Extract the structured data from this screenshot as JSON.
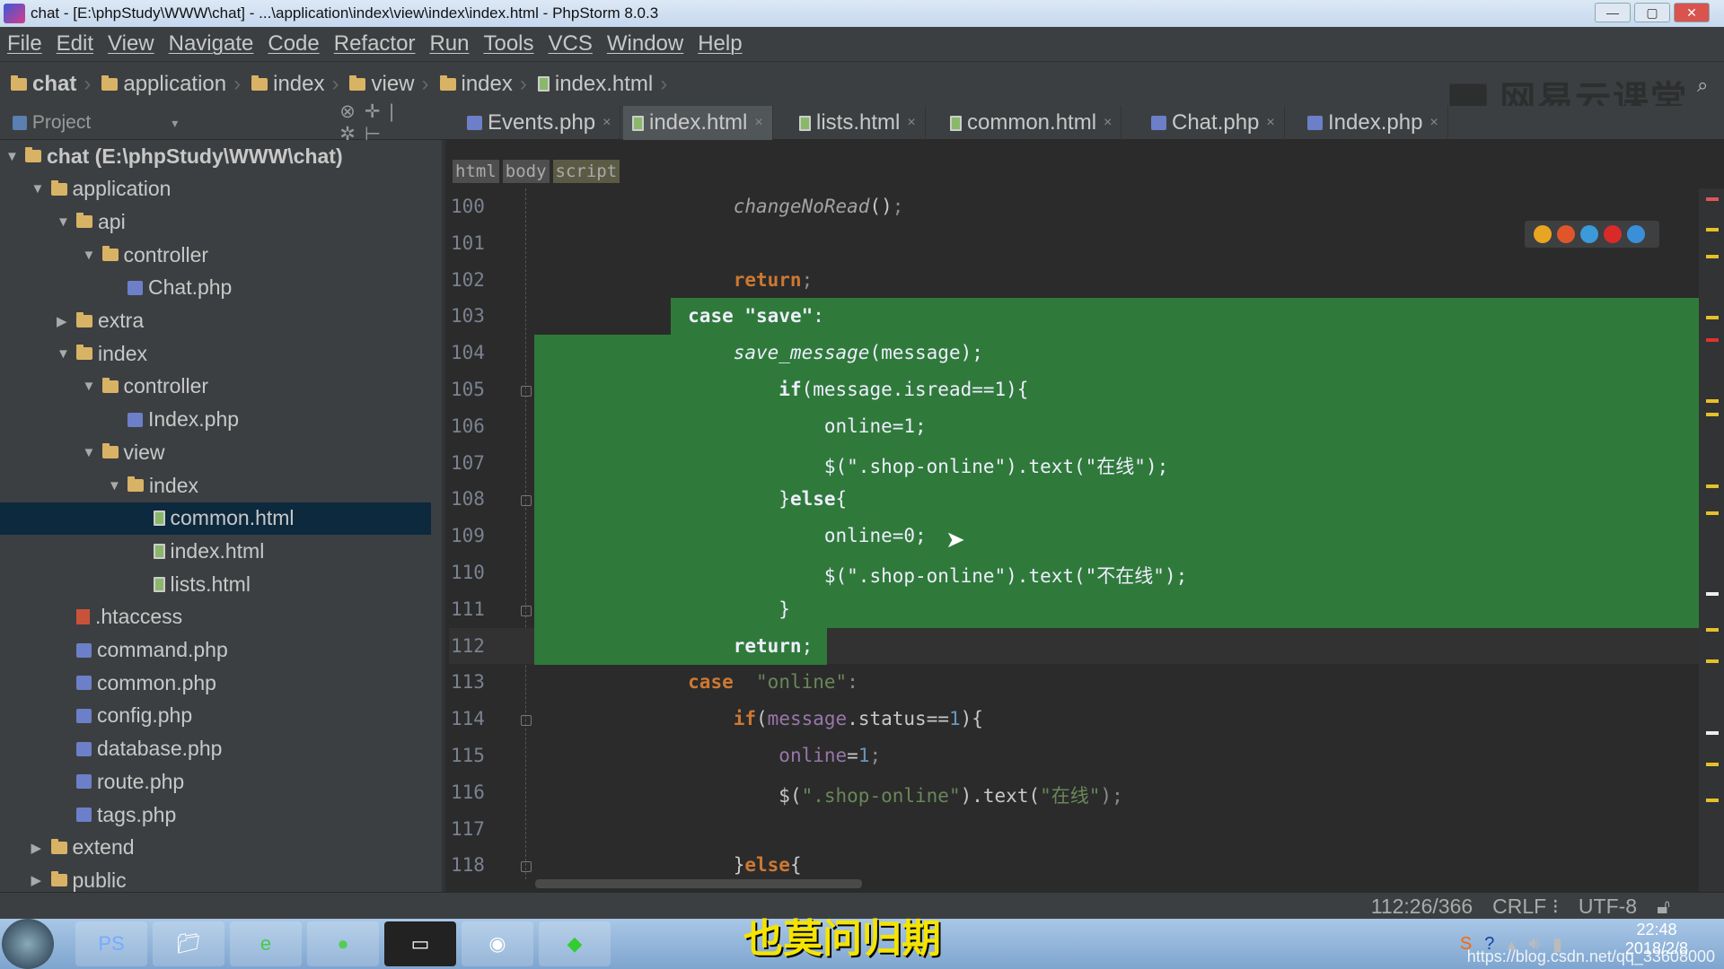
{
  "window": {
    "title": "chat - [E:\\phpStudy\\WWW\\chat] - ...\\application\\index\\view\\index\\index.html - PhpStorm 8.0.3",
    "min": "—",
    "max": "▢",
    "close": "✕"
  },
  "menu": [
    "File",
    "Edit",
    "View",
    "Navigate",
    "Code",
    "Refactor",
    "Run",
    "Tools",
    "VCS",
    "Window",
    "Help"
  ],
  "breadcrumb": [
    {
      "label": "chat",
      "icon": "folder"
    },
    {
      "label": "application",
      "icon": "folder"
    },
    {
      "label": "index",
      "icon": "folder"
    },
    {
      "label": "view",
      "icon": "folder"
    },
    {
      "label": "index",
      "icon": "folder"
    },
    {
      "label": "index.html",
      "icon": "html-file"
    }
  ],
  "watermark": "网易云课堂",
  "project_panel": {
    "label": "Project"
  },
  "tabs": [
    {
      "label": "Events.php",
      "icon": "php"
    },
    {
      "label": "index.html",
      "icon": "html",
      "active": true
    },
    {
      "label": "lists.html",
      "icon": "html"
    },
    {
      "label": "common.html",
      "icon": "html"
    },
    {
      "label": "Chat.php",
      "icon": "php"
    },
    {
      "label": "Index.php",
      "icon": "php"
    }
  ],
  "tab_close": "×",
  "tree": [
    {
      "label": "chat (E:\\phpStudy\\WWW\\chat)",
      "level": 0,
      "type": "folder",
      "expanded": true
    },
    {
      "label": "application",
      "level": 1,
      "type": "folder",
      "expanded": true
    },
    {
      "label": "api",
      "level": 2,
      "type": "folder",
      "expanded": true
    },
    {
      "label": "controller",
      "level": 3,
      "type": "folder",
      "expanded": true
    },
    {
      "label": "Chat.php",
      "level": 4,
      "type": "php"
    },
    {
      "label": "extra",
      "level": 2,
      "type": "folder",
      "expanded": false
    },
    {
      "label": "index",
      "level": 2,
      "type": "folder",
      "expanded": true
    },
    {
      "label": "controller",
      "level": 3,
      "type": "folder",
      "expanded": true
    },
    {
      "label": "Index.php",
      "level": 4,
      "type": "php"
    },
    {
      "label": "view",
      "level": 3,
      "type": "folder",
      "expanded": true
    },
    {
      "label": "index",
      "level": 4,
      "type": "folder",
      "expanded": true
    },
    {
      "label": "common.html",
      "level": 5,
      "type": "html",
      "selected": true
    },
    {
      "label": "index.html",
      "level": 5,
      "type": "html"
    },
    {
      "label": "lists.html",
      "level": 5,
      "type": "html"
    },
    {
      "label": ".htaccess",
      "level": 2,
      "type": "htaccess"
    },
    {
      "label": "command.php",
      "level": 2,
      "type": "php"
    },
    {
      "label": "common.php",
      "level": 2,
      "type": "php"
    },
    {
      "label": "config.php",
      "level": 2,
      "type": "php"
    },
    {
      "label": "database.php",
      "level": 2,
      "type": "php"
    },
    {
      "label": "route.php",
      "level": 2,
      "type": "php"
    },
    {
      "label": "tags.php",
      "level": 2,
      "type": "php"
    },
    {
      "label": "extend",
      "level": 1,
      "type": "folder",
      "expanded": false
    },
    {
      "label": "public",
      "level": 1,
      "type": "folder",
      "expanded": false
    }
  ],
  "editor_breadcrumb": [
    "html",
    "body",
    "script"
  ],
  "code": [
    {
      "num": "100",
      "tokens": [
        {
          "t": "            "
        },
        {
          "t": "changeNoRead",
          "c": "i"
        },
        {
          "t": "()",
          "c": "d"
        },
        {
          "t": ";",
          "c": "p"
        }
      ]
    },
    {
      "num": "101",
      "tokens": []
    },
    {
      "num": "102",
      "tokens": [
        {
          "t": "            "
        },
        {
          "t": "return",
          "c": "k"
        },
        {
          "t": ";",
          "c": "p"
        }
      ]
    },
    {
      "num": "103",
      "sel": true,
      "tokens": [
        {
          "t": "        "
        },
        {
          "t": "case",
          "c": "k"
        },
        {
          "t": " "
        },
        {
          "t": "\"save\"",
          "c": "s k"
        },
        {
          "t": ":"
        }
      ]
    },
    {
      "num": "104",
      "sel": true,
      "tokens": [
        {
          "t": "            "
        },
        {
          "t": "save_message",
          "c": "i"
        },
        {
          "t": "(message)"
        },
        {
          "t": ";"
        }
      ]
    },
    {
      "num": "105",
      "sel": true,
      "tokens": [
        {
          "t": "                "
        },
        {
          "t": "if",
          "c": "k"
        },
        {
          "t": "(message.isread==1){"
        }
      ]
    },
    {
      "num": "106",
      "sel": true,
      "tokens": [
        {
          "t": "                    "
        },
        {
          "t": "online=1;"
        }
      ]
    },
    {
      "num": "107",
      "sel": true,
      "tokens": [
        {
          "t": "                    "
        },
        {
          "t": "$(\".shop-online\").text(\"在线\");"
        }
      ]
    },
    {
      "num": "108",
      "sel": true,
      "tokens": [
        {
          "t": "                "
        },
        {
          "t": "}"
        },
        {
          "t": "else",
          "c": "k"
        },
        {
          "t": "{"
        }
      ]
    },
    {
      "num": "109",
      "sel": true,
      "tokens": [
        {
          "t": "                    "
        },
        {
          "t": "online=0;"
        }
      ]
    },
    {
      "num": "110",
      "sel": true,
      "tokens": [
        {
          "t": "                    "
        },
        {
          "t": "$(\".shop-online\").text(\"不在线\");"
        }
      ]
    },
    {
      "num": "111",
      "sel": true,
      "tokens": [
        {
          "t": "                "
        },
        {
          "t": "}"
        }
      ]
    },
    {
      "num": "112",
      "sel": true,
      "current": true,
      "tokens": [
        {
          "t": "            "
        },
        {
          "t": "return",
          "c": "k"
        },
        {
          "t": ";"
        }
      ]
    },
    {
      "num": "113",
      "tokens": [
        {
          "t": "        "
        },
        {
          "t": "case",
          "c": "k"
        },
        {
          "t": "  "
        },
        {
          "t": "\"online\"",
          "c": "s"
        },
        {
          "t": ":",
          "c": "p"
        }
      ]
    },
    {
      "num": "114",
      "tokens": [
        {
          "t": "            "
        },
        {
          "t": "if",
          "c": "k"
        },
        {
          "t": "(",
          "c": "d"
        },
        {
          "t": "message",
          "c": "v"
        },
        {
          "t": ".status==",
          "c": "d"
        },
        {
          "t": "1",
          "c": "n"
        },
        {
          "t": "){",
          "c": "d"
        }
      ]
    },
    {
      "num": "115",
      "tokens": [
        {
          "t": "                "
        },
        {
          "t": "online",
          "c": "v"
        },
        {
          "t": "=",
          "c": "d"
        },
        {
          "t": "1",
          "c": "n"
        },
        {
          "t": ";",
          "c": "p"
        }
      ]
    },
    {
      "num": "116",
      "tokens": [
        {
          "t": "                "
        },
        {
          "t": "$(",
          "c": "d"
        },
        {
          "t": "\".shop-online\"",
          "c": "s"
        },
        {
          "t": ").text(",
          "c": "d"
        },
        {
          "t": "\"在线\"",
          "c": "s"
        },
        {
          "t": ");",
          "c": "p"
        }
      ]
    },
    {
      "num": "117",
      "tokens": []
    },
    {
      "num": "118",
      "tokens": [
        {
          "t": "            "
        },
        {
          "t": "}",
          "c": "d"
        },
        {
          "t": "else",
          "c": "k"
        },
        {
          "t": "{",
          "c": "d"
        }
      ]
    }
  ],
  "status": {
    "position": "112:26/366",
    "line_sep": "CRLF ⁝",
    "encoding": "UTF-8"
  },
  "taskbar": {
    "subtitle": "也莫问归期",
    "clock": "22:48",
    "date": "2018/2/8",
    "csdn": "https://blog.csdn.net/qq_33608000"
  },
  "colors": {
    "selection": "#2f7a3a",
    "keyword": "#cc7832",
    "string": "#6a8759",
    "background": "#2b2b2b"
  }
}
